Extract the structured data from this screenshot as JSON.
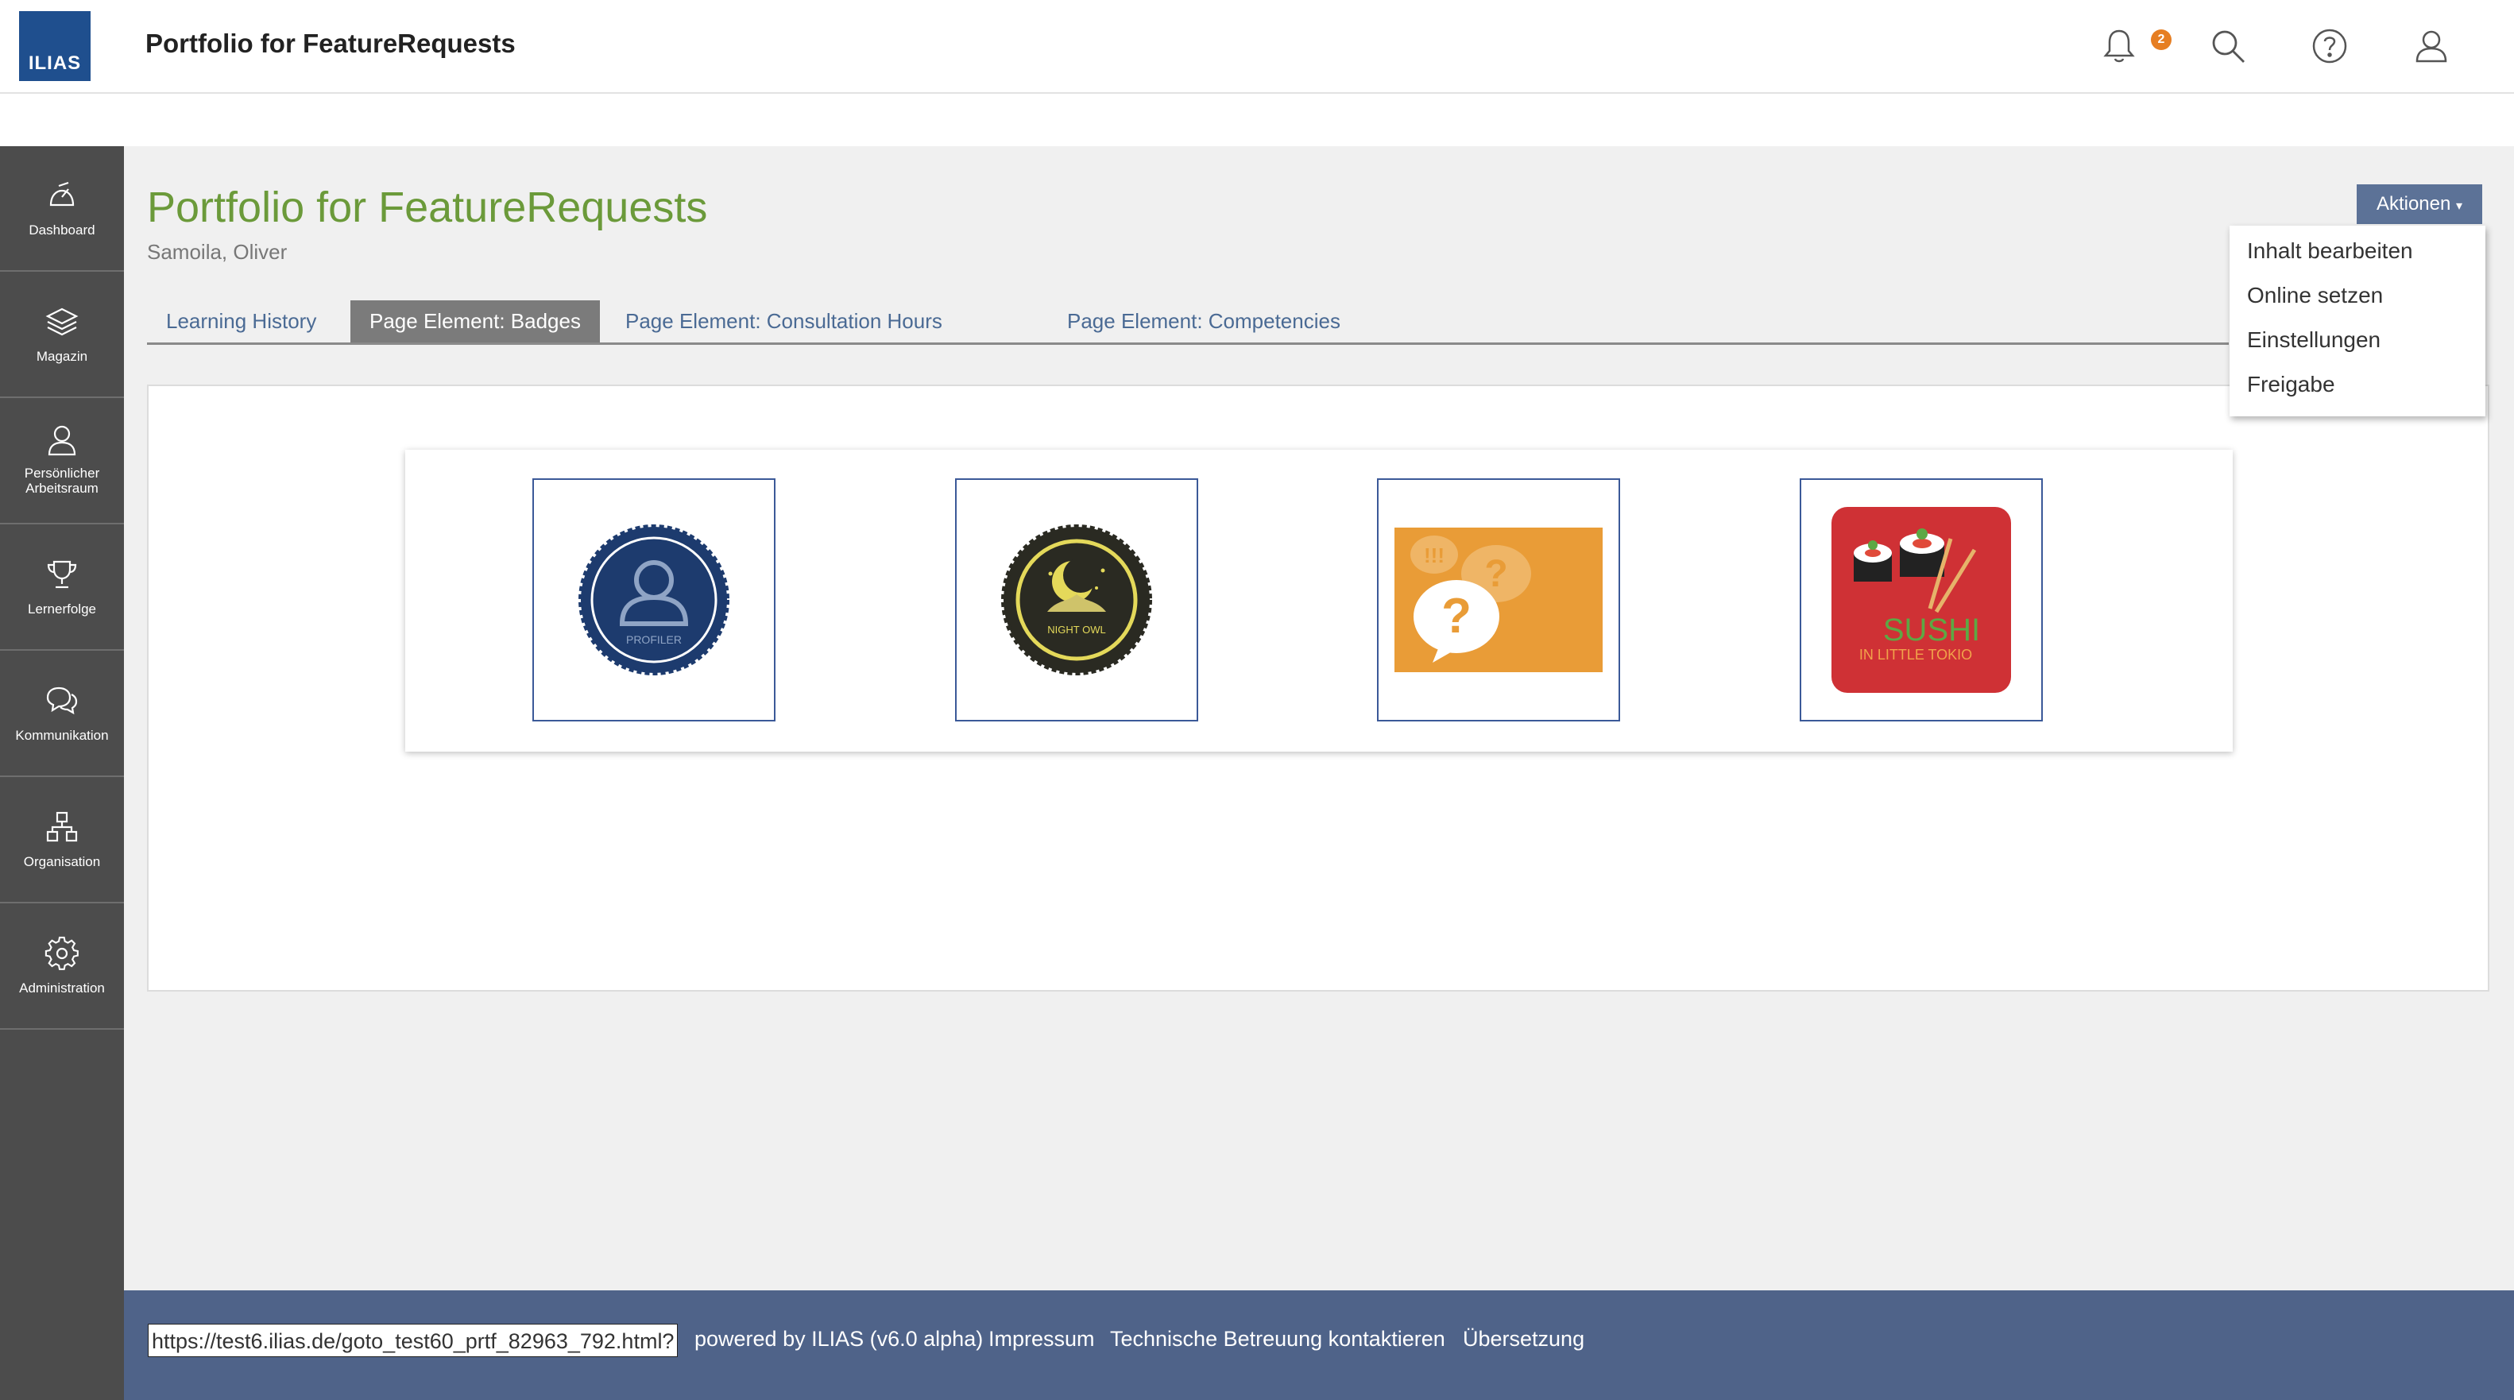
{
  "header": {
    "logo_text": "ILIAS",
    "title": "Portfolio for FeatureRequests",
    "notification_count": "2",
    "icons": [
      "bell-icon",
      "search-icon",
      "help-icon",
      "user-icon"
    ]
  },
  "sidebar": {
    "items": [
      {
        "label": "Dashboard",
        "icon": "dashboard-icon"
      },
      {
        "label": "Magazin",
        "icon": "layers-icon"
      },
      {
        "label_line1": "Persönlicher",
        "label_line2": "Arbeitsraum",
        "icon": "person-icon"
      },
      {
        "label": "Lernerfolge",
        "icon": "trophy-icon"
      },
      {
        "label": "Kommunikation",
        "icon": "chat-icon"
      },
      {
        "label": "Organisation",
        "icon": "org-icon"
      },
      {
        "label": "Administration",
        "icon": "gear-icon"
      }
    ]
  },
  "main": {
    "title": "Portfolio for FeatureRequests",
    "owner": "Samoila, Oliver",
    "tabs": [
      {
        "label": "Learning History",
        "active": false
      },
      {
        "label": "Page Element: Badges",
        "active": true
      },
      {
        "label": "Page Element: Consultation Hours",
        "active": false
      },
      {
        "label": "Page Element: Competencies",
        "active": false
      }
    ],
    "badges": [
      {
        "name": "profiler-badge",
        "text": "PROFILER"
      },
      {
        "name": "night-owl-badge",
        "text": "NIGHT OWL"
      },
      {
        "name": "questions-badge",
        "text": "!!!"
      },
      {
        "name": "sushi-badge",
        "text": "SUSHI",
        "subtext": "IN LITTLE TOKIO"
      }
    ]
  },
  "actions": {
    "button_label": "Aktionen",
    "menu": [
      "Inhalt bearbeiten",
      "Online setzen",
      "Einstellungen",
      "Freigabe"
    ]
  },
  "footer": {
    "url": "https://test6.ilias.de/goto_test60_prtf_82963_792.html?",
    "links": [
      "powered by ILIAS (v6.0 alpha)",
      "Impressum",
      "Technische Betreuung kontaktieren",
      "Übersetzung"
    ]
  },
  "colors": {
    "accent_green": "#6b9a3a",
    "sidebar_bg": "#4c4c4c",
    "footer_bg": "#4f6389",
    "logo_blue": "#1f4f8e",
    "actions_btn": "#5c7297",
    "notification": "#e67e22"
  }
}
